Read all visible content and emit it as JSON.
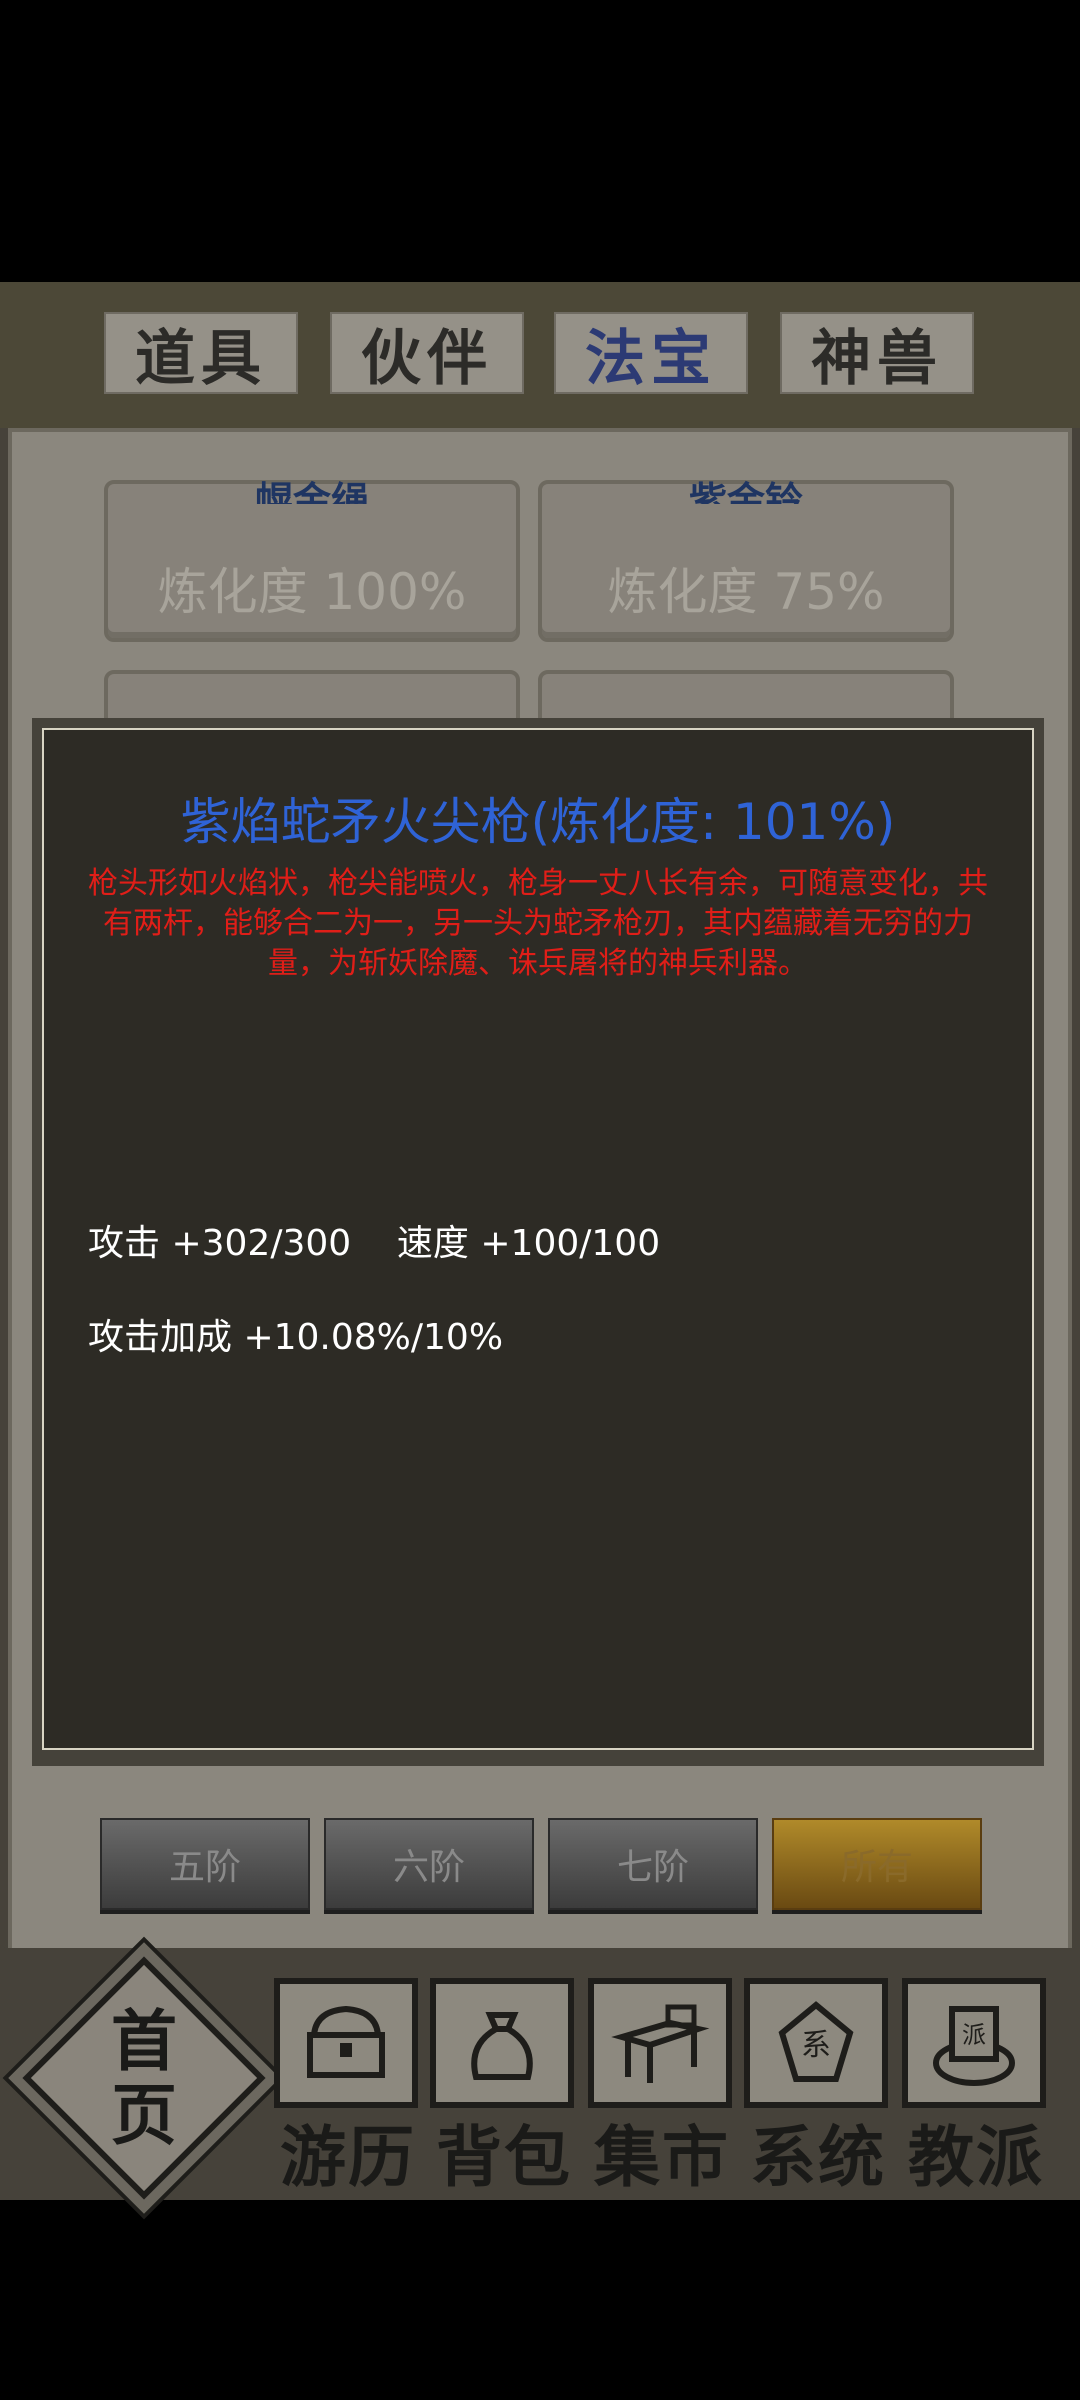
{
  "tabs": [
    {
      "label": "道具"
    },
    {
      "label": "伙伴"
    },
    {
      "label": "法宝",
      "active": true
    },
    {
      "label": "神兽"
    }
  ],
  "items": [
    {
      "name": "幌金绳",
      "refine": "炼化度 100%"
    },
    {
      "name": "紫金铃",
      "refine": "炼化度 75%"
    }
  ],
  "filters": [
    {
      "label": "五阶"
    },
    {
      "label": "六阶"
    },
    {
      "label": "七阶"
    },
    {
      "label": "所有",
      "active": true
    }
  ],
  "modal": {
    "title": "紫焰蛇矛火尖枪(炼化度: 101%)",
    "description": "枪头形如火焰状，枪尖能喷火，枪身一丈八长有余，可随意变化，共有两杆，能够合二为一，另一头为蛇矛枪刃，其内蕴藏着无穷的力量，为斩妖除魔、诛兵屠将的神兵利器。",
    "stats": [
      {
        "text": "攻击 +302/300    速度 +100/100"
      },
      {
        "text": "攻击加成 +10.08%/10%"
      }
    ]
  },
  "nav": {
    "home": "首页",
    "items": [
      {
        "label": "游历",
        "icon": "chest-icon"
      },
      {
        "label": "背包",
        "icon": "bag-icon"
      },
      {
        "label": "集市",
        "icon": "market-stall-icon"
      },
      {
        "label": "系统",
        "icon": "system-seal-icon"
      },
      {
        "label": "教派",
        "icon": "sect-scroll-icon"
      }
    ]
  },
  "colors": {
    "title_blue": "#2f63d6",
    "description_red": "#e01e18",
    "active_filter_gold": "#b08a2a"
  }
}
